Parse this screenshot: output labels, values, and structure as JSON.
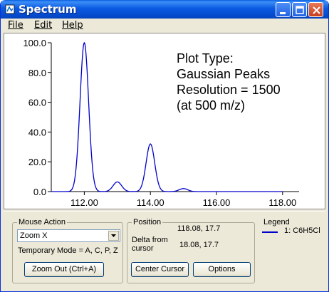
{
  "window": {
    "title": "Spectrum"
  },
  "menu": {
    "file": "File",
    "edit": "Edit",
    "help": "Help"
  },
  "annotation": {
    "line1": "Plot Type:",
    "line2": "Gaussian Peaks",
    "line3": "Resolution = 1500",
    "line4": "(at 500 m/z)"
  },
  "chart_data": {
    "type": "line",
    "xlim": [
      111,
      118.5
    ],
    "ylim": [
      0,
      100
    ],
    "xticks": [
      "112.00",
      "114.00",
      "116.00",
      "118.00"
    ],
    "xtick_values": [
      112,
      114,
      116,
      118
    ],
    "yticks": [
      "0.0",
      "20.0",
      "40.0",
      "60.0",
      "80.0",
      "100.0"
    ],
    "ytick_values": [
      0,
      20,
      40,
      60,
      80,
      100
    ],
    "peaks": [
      {
        "x": 112.0,
        "y": 100.0
      },
      {
        "x": 113.0,
        "y": 6.5
      },
      {
        "x": 114.0,
        "y": 32.0
      },
      {
        "x": 115.0,
        "y": 2.0
      }
    ],
    "series_color": "#0000cc"
  },
  "mouse_action": {
    "group_label": "Mouse Action",
    "selected": "Zoom X",
    "temp_mode": "Temporary Mode = A, C, P, Z",
    "zoom_out": "Zoom Out (Ctrl+A)"
  },
  "position": {
    "group_label": "Position",
    "cursor_value": "118.08, 17.7",
    "delta_label_1": "Delta from",
    "delta_label_2": "cursor",
    "delta_value": "18.08, 17.7",
    "center_cursor": "Center Cursor",
    "options": "Options"
  },
  "legend": {
    "group_label": "Legend",
    "entry": "1: C6H5Cl",
    "color": "#0000cc"
  }
}
